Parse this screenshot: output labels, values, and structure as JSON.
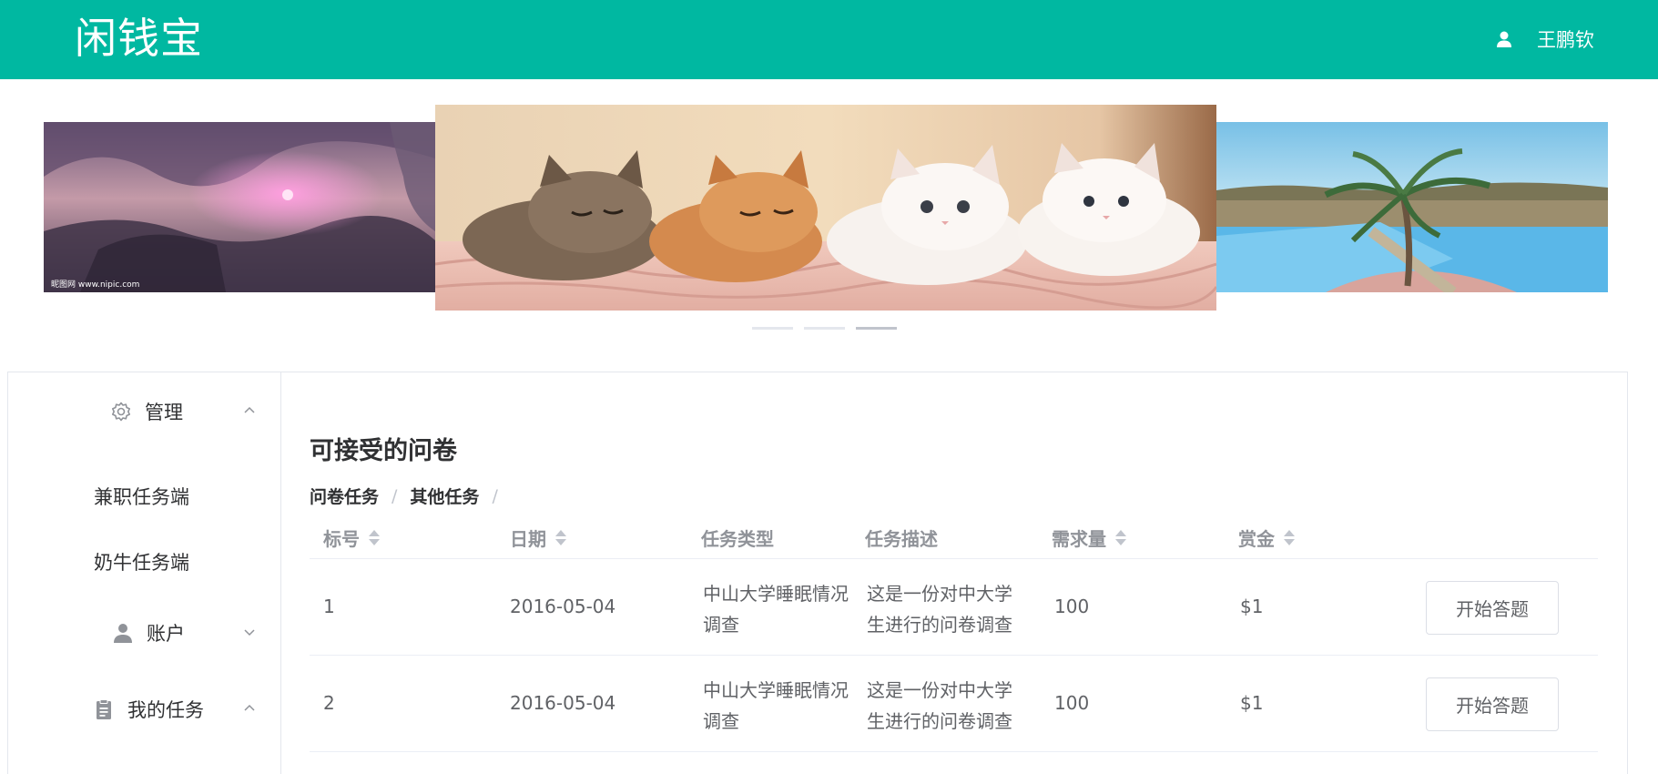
{
  "header": {
    "logo": "闲钱宝",
    "username": "王鹏钦",
    "icon": "user-icon"
  },
  "carousel": {
    "slides": [
      "fantasy-landscape-image",
      "kittens-image",
      "palm-pool-image"
    ],
    "indicator_count": 3,
    "active_indicator": 3,
    "watermark": "昵图网 www.nipic.com"
  },
  "sidebar": {
    "manage": {
      "label": "管理",
      "icon": "gear-icon",
      "expanded": true
    },
    "manage_items": [
      "兼职任务端",
      "奶牛任务端"
    ],
    "account": {
      "label": "账户",
      "icon": "user-icon",
      "expanded": false
    },
    "mytasks": {
      "label": "我的任务",
      "icon": "clipboard-icon",
      "expanded": true
    }
  },
  "main": {
    "title": "可接受的问卷",
    "breadcrumb": [
      "问卷任务",
      "其他任务"
    ],
    "columns": [
      "标号",
      "日期",
      "任务类型",
      "任务描述",
      "需求量",
      "赏金"
    ],
    "rows": [
      {
        "id": "1",
        "date": "2016-05-04",
        "type": "中山大学睡眠情况调查",
        "desc": "这是一份对中大学生进行的问卷调查",
        "quantity": "100",
        "reward": "$1",
        "action": "开始答题"
      },
      {
        "id": "2",
        "date": "2016-05-04",
        "type": "中山大学睡眠情况调查",
        "desc": "这是一份对中大学生进行的问卷调查",
        "quantity": "100",
        "reward": "$1",
        "action": "开始答题"
      }
    ]
  },
  "colors": {
    "brand": "#00b8a1",
    "text": "#303133",
    "muted": "#909399"
  }
}
